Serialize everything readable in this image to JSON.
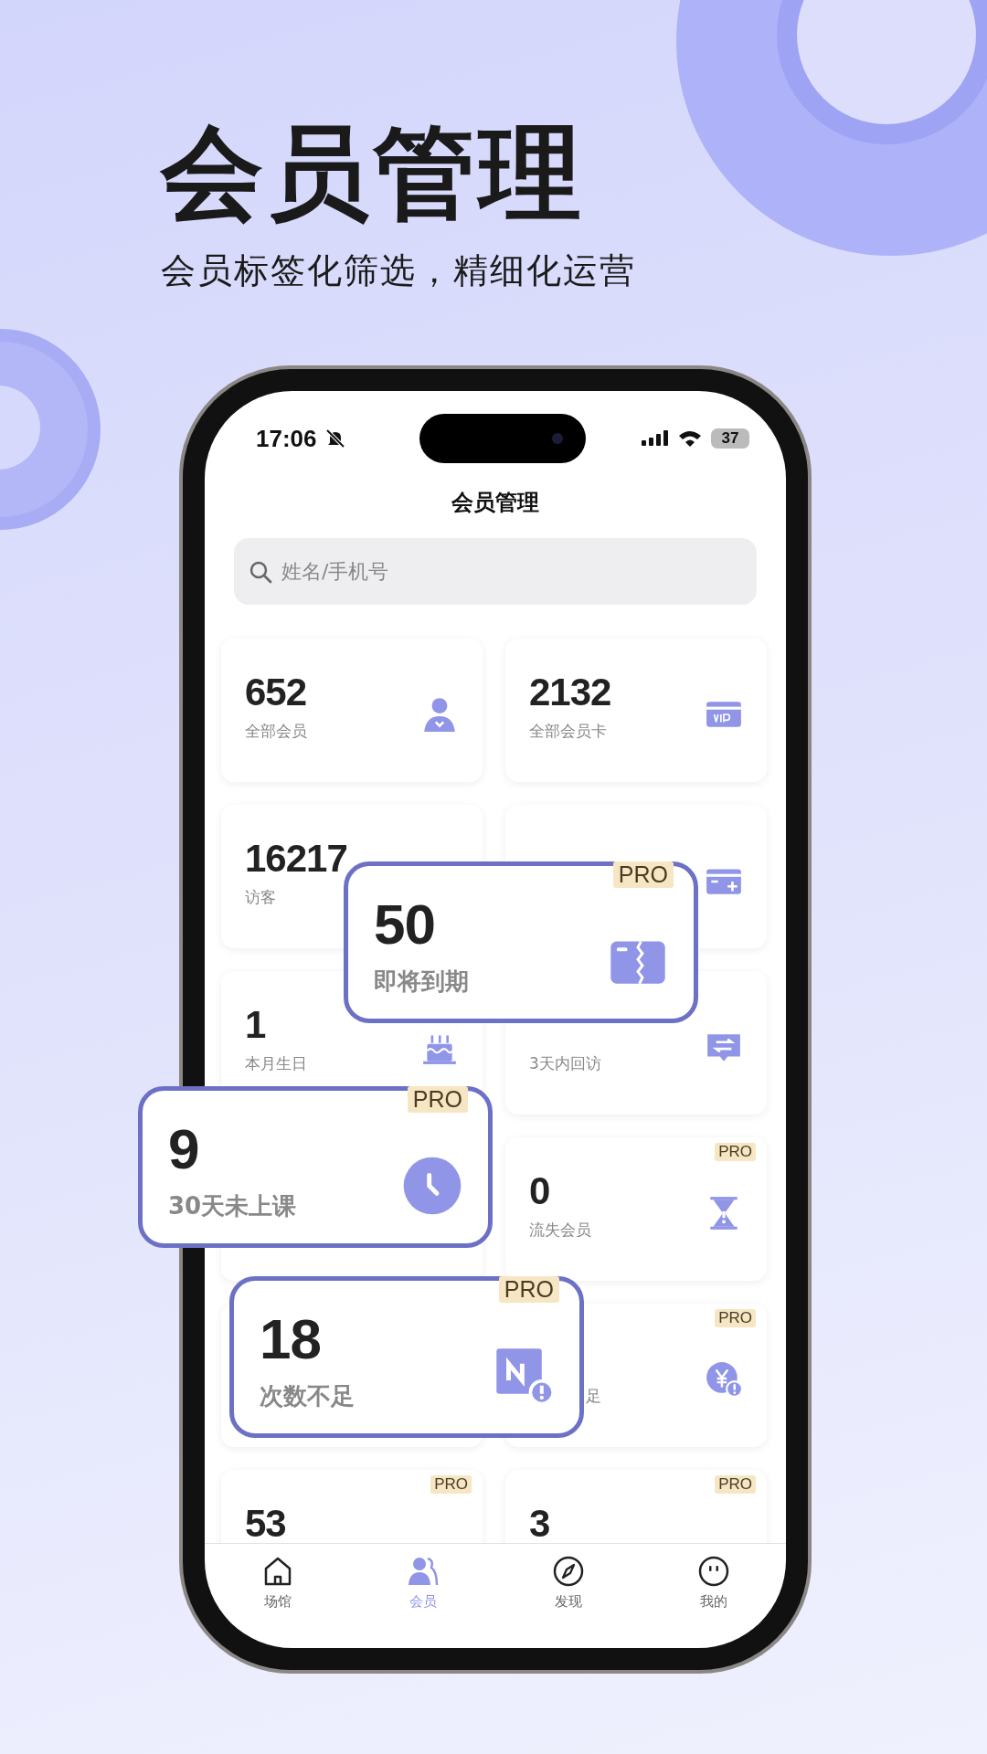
{
  "headline": "会员管理",
  "subheadline": "会员标签化筛选，精细化运营",
  "status_bar": {
    "time": "17:06",
    "battery": "37"
  },
  "title": "会员管理",
  "search": {
    "placeholder": "姓名/手机号"
  },
  "cards": [
    {
      "kind": "person",
      "value": "652",
      "label": "全部会员"
    },
    {
      "kind": "vip",
      "value": "2132",
      "label": "全部会员卡"
    },
    {
      "kind": "plain",
      "value": "16217",
      "label": "访客"
    },
    {
      "kind": "card-plus"
    },
    {
      "kind": "cake",
      "value": "1",
      "label": "本月生日"
    },
    {
      "kind": "swap",
      "label": "3天内回访"
    },
    {
      "kind": "plain"
    },
    {
      "kind": "hourglass",
      "value": "0",
      "label": "流失会员",
      "badge": "PRO"
    },
    {
      "kind": "plain"
    },
    {
      "kind": "yen-alert",
      "label": "足",
      "badge": "PRO",
      "covered": true
    },
    {
      "kind": "plain",
      "value": "53",
      "badge": "PRO"
    },
    {
      "kind": "plain",
      "value": "3",
      "badge": "PRO"
    }
  ],
  "highlights": [
    {
      "kind": "card-torn",
      "value": "50",
      "label": "即将到期",
      "badge": "PRO"
    },
    {
      "kind": "clock",
      "value": "9",
      "label": "30天未上课",
      "badge": "PRO"
    },
    {
      "kind": "n-alert",
      "value": "18",
      "label": "次数不足",
      "badge": "PRO"
    }
  ],
  "tabs": [
    {
      "kind": "home",
      "label": "场馆",
      "selected": false
    },
    {
      "kind": "members",
      "label": "会员",
      "selected": true
    },
    {
      "kind": "compass",
      "label": "发现",
      "selected": false
    },
    {
      "kind": "face",
      "label": "我的",
      "selected": false
    }
  ]
}
